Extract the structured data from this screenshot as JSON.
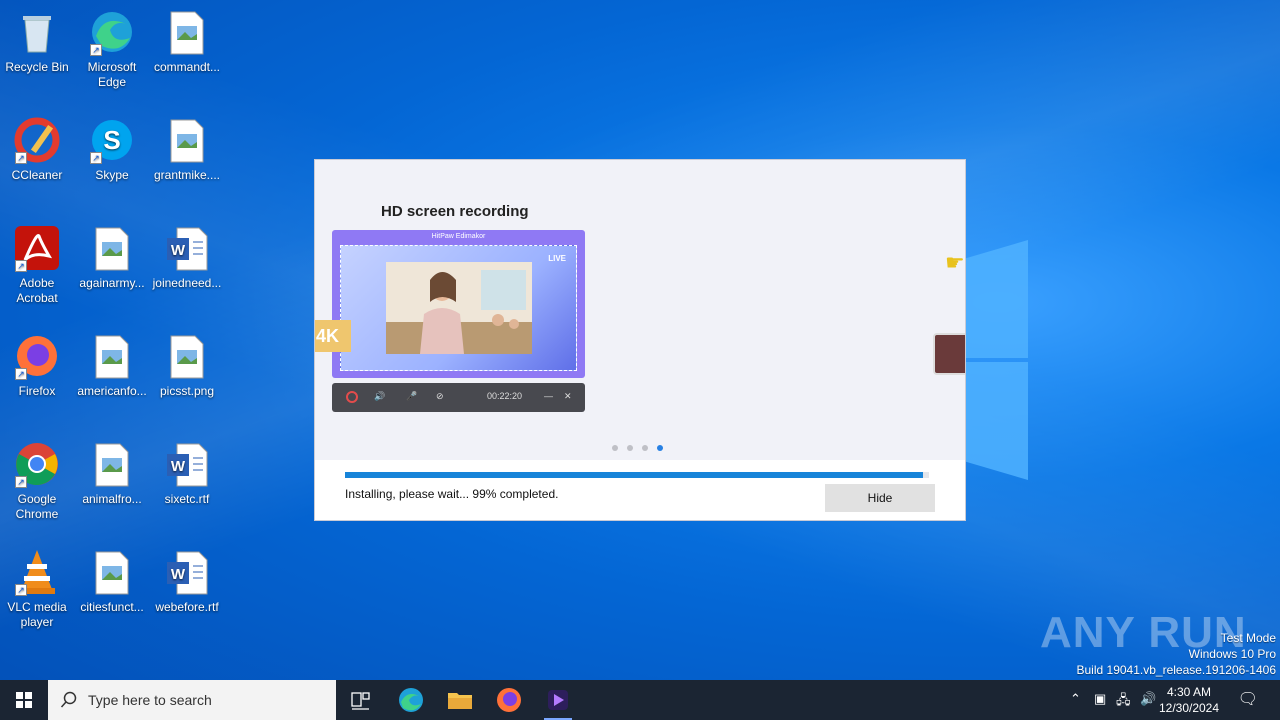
{
  "desktop": {
    "icons": [
      {
        "label": "Recycle Bin",
        "icon": "recycle-bin-icon"
      },
      {
        "label": "Microsoft Edge",
        "icon": "edge-icon"
      },
      {
        "label": "commandt...",
        "icon": "image-file-icon"
      },
      {
        "label": "CCleaner",
        "icon": "ccleaner-icon"
      },
      {
        "label": "Skype",
        "icon": "skype-icon"
      },
      {
        "label": "grantmike....",
        "icon": "image-file-icon"
      },
      {
        "label": "Adobe Acrobat",
        "icon": "acrobat-icon"
      },
      {
        "label": "againarmy...",
        "icon": "image-file-icon"
      },
      {
        "label": "joinedneed...",
        "icon": "word-doc-icon"
      },
      {
        "label": "Firefox",
        "icon": "firefox-icon"
      },
      {
        "label": "americanfo...",
        "icon": "image-file-icon"
      },
      {
        "label": "picsst.png",
        "icon": "image-file-icon"
      },
      {
        "label": "Google Chrome",
        "icon": "chrome-icon"
      },
      {
        "label": "animalfro...",
        "icon": "image-file-icon"
      },
      {
        "label": "sixetc.rtf",
        "icon": "word-doc-icon"
      },
      {
        "label": "VLC media player",
        "icon": "vlc-icon"
      },
      {
        "label": "citiesfunct...",
        "icon": "image-file-icon"
      },
      {
        "label": "webefore.rtf",
        "icon": "word-doc-icon"
      }
    ]
  },
  "installer": {
    "slide_title": "HD screen recording",
    "preview_app_title": "HitPaw Edimakor",
    "live_label": "LIVE",
    "badge_4k": "4K",
    "recorder_time": "00:22:20",
    "carousel_active_index": 3,
    "carousel_count": 4,
    "progress_percent": 99,
    "status_text": "Installing, please wait... 99% completed.",
    "hide_label": "Hide"
  },
  "watermark": {
    "brand": "ANY RUN",
    "line1": "Test Mode",
    "line2": "Windows 10 Pro",
    "line3": "Build 19041.vb_release.191206-1406"
  },
  "taskbar": {
    "search_placeholder": "Type here to search",
    "time": "4:30 AM",
    "date": "12/30/2024"
  },
  "colors": {
    "accent": "#1784d9",
    "taskbar": "#1b2533",
    "preview_purple": "#8f79f4"
  }
}
